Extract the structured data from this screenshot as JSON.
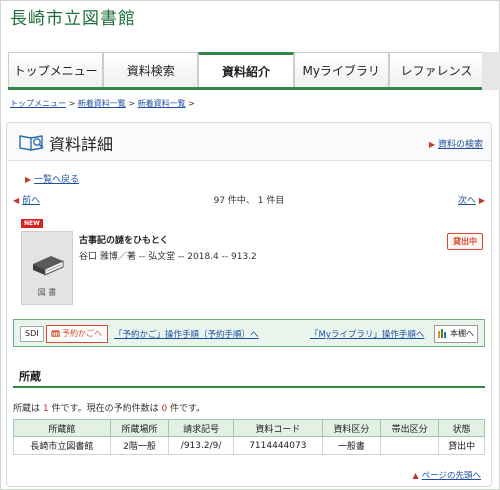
{
  "site": {
    "title": "長崎市立図書館"
  },
  "nav": {
    "tabs": [
      {
        "label": "トップメニュー",
        "active": false
      },
      {
        "label": "資料検索",
        "active": false
      },
      {
        "label": "資料紹介",
        "active": true
      },
      {
        "label": "Myライブラリ",
        "active": false
      },
      {
        "label": "レファレンス",
        "active": false
      }
    ]
  },
  "breadcrumb": {
    "items": [
      "トップメニュー",
      "新着資料一覧",
      "新着資料一覧"
    ],
    "separator": ">"
  },
  "panel": {
    "title": "資料詳細",
    "search_link": "資料の検索",
    "back_link": "一覧へ戻る"
  },
  "pager": {
    "prev": "前へ",
    "count": "97 件中、 1 件目",
    "next": "次へ"
  },
  "item": {
    "badge": "NEW",
    "thumb_label": "図 書",
    "title": "古事記の謎をひもとく",
    "meta": "谷口 雅博／著 -- 弘文堂 -- 2018.4 -- 913.2",
    "status": "貸出中"
  },
  "actions": {
    "sdi": "SDI",
    "cart": "予約かごへ",
    "cart_guide": "「予約かご」操作手順（予約手順）へ",
    "mylib_guide": "「Myライブラリ」操作手順へ",
    "shelf": "本棚へ"
  },
  "holdings": {
    "title": "所蔵",
    "summary_pre": "所蔵は ",
    "summary_count": "1",
    "summary_mid": " 件です。現在の予約件数は ",
    "summary_reserve": "0",
    "summary_post": " 件です。",
    "columns": [
      "所蔵館",
      "所蔵場所",
      "請求記号",
      "資料コード",
      "資料区分",
      "帯出区分",
      "状態"
    ],
    "rows": [
      [
        "長崎市立図書館",
        "2階一般",
        "/913.2/9/",
        "7114444073",
        "一般書",
        "",
        "貸出中"
      ]
    ]
  },
  "footer": {
    "page_top": "ページの先頭へ"
  },
  "colors": {
    "brand_green": "#2f8a4c",
    "link_blue": "#1f4fa3",
    "alert_red": "#d62424"
  }
}
